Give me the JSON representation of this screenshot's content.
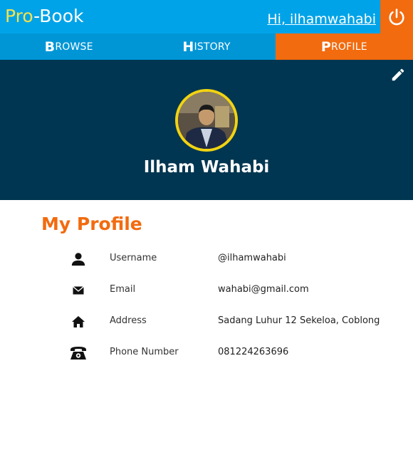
{
  "header": {
    "logo_part1": "Pro",
    "logo_part2": "-Book",
    "greeting": "Hi, ilhamwahabi",
    "logout_icon": "power-icon"
  },
  "nav": {
    "tabs": [
      {
        "cap": "B",
        "rest": "rowse",
        "active": false
      },
      {
        "cap": "H",
        "rest": "istory",
        "active": false
      },
      {
        "cap": "P",
        "rest": "rofile",
        "active": true
      }
    ]
  },
  "profile": {
    "name": "Ilham Wahabi",
    "edit_icon": "pencil-icon"
  },
  "section": {
    "title": "My Profile"
  },
  "fields": [
    {
      "icon": "user-icon",
      "label": "Username",
      "value": "@ilhamwahabi"
    },
    {
      "icon": "envelope-icon",
      "label": "Email",
      "value": "wahabi@gmail.com"
    },
    {
      "icon": "home-icon",
      "label": "Address",
      "value": "Sadang Luhur 12 Sekeloa, Coblong"
    },
    {
      "icon": "phone-icon",
      "label": "Phone Number",
      "value": "081224263696"
    }
  ],
  "colors": {
    "header_blue": "#00a3e8",
    "nav_blue": "#0096d6",
    "accent_orange": "#f26b0f",
    "banner_navy": "#003651",
    "logo_yellow": "#f7e24a",
    "avatar_ring": "#f1d312"
  }
}
